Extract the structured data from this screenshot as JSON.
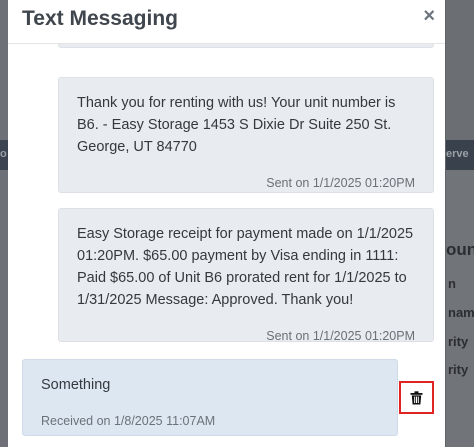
{
  "modal": {
    "title": "Text Messaging",
    "close_label": "×"
  },
  "messages": [
    {
      "direction": "sent",
      "text": "Thank you for renting with us! Your unit number is B6. - Easy Storage 1453 S Dixie Dr Suite 250 St. George, UT 84770",
      "meta": "Sent on 1/1/2025 01:20PM"
    },
    {
      "direction": "sent",
      "text": "Easy Storage receipt for payment made on 1/1/2025 01:20PM. $65.00 payment by Visa ending in 1111: Paid $65.00 of Unit B6 prorated rent for 1/1/2025 to 1/31/2025 Message: Approved. Thank you!",
      "meta": "Sent on 1/1/2025 01:20PM"
    },
    {
      "direction": "received",
      "text": "Something",
      "meta": "Received on 1/8/2025 11:07AM"
    }
  ],
  "background_fragments": {
    "left_text": "o",
    "right_top": "erve",
    "right_1": "oun",
    "right_2": "n",
    "right_3": "nam",
    "right_4": "rity",
    "right_5": "rity"
  },
  "icons": {
    "delete": "trash-icon",
    "close": "close-icon"
  },
  "colors": {
    "delete_highlight": "#e02424",
    "sent_bubble": "#e8ebef",
    "received_bubble": "#dde7f1"
  }
}
